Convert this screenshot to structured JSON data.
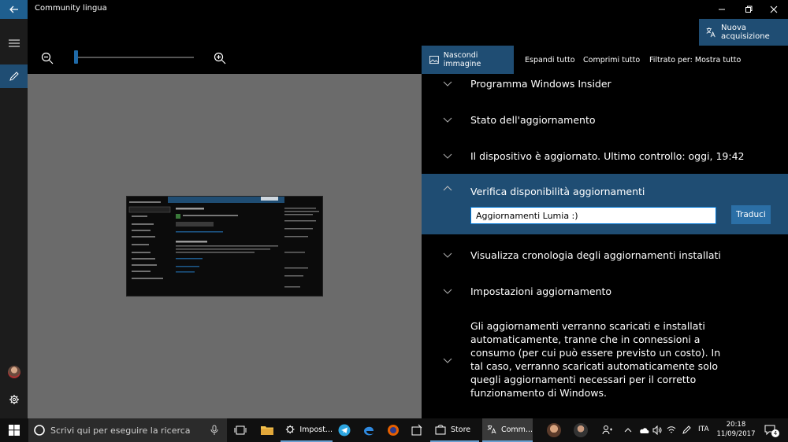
{
  "window": {
    "title": "Community lingua"
  },
  "header": {
    "new_acquisition": "Nuova acquisizione"
  },
  "toolbar": {
    "hide_image": "Nascondi immagine",
    "expand_all": "Espandi tutto",
    "collapse_all": "Comprimi tutto",
    "filter": "Filtrato per: Mostra tutto"
  },
  "list": {
    "items": [
      {
        "label": "Programma Windows Insider"
      },
      {
        "label": "Stato dell'aggiornamento"
      },
      {
        "label": "Il dispositivo è aggiornato. Ultimo controllo: oggi, 19:42"
      },
      {
        "label": "Verifica disponibilità aggiornamenti",
        "translation_value": "Aggiornamenti Lumia :)",
        "translate_button": "Traduci"
      },
      {
        "label": "Visualizza cronologia degli aggiornamenti installati"
      },
      {
        "label": "Impostazioni aggiornamento"
      },
      {
        "label": "Gli aggiornamenti verranno scaricati e installati automaticamente, tranne che in connessioni a consumo (per cui può essere previsto un costo). In tal caso, verranno scaricati automaticamente solo quegli aggiornamenti necessari per il corretto funzionamento di Windows."
      }
    ]
  },
  "zoom": {
    "level": 0.0
  },
  "taskbar": {
    "search_placeholder": "Scrivi qui per eseguire la ricerca",
    "apps": [
      {
        "label": "Impost..."
      },
      {
        "label": "Store"
      },
      {
        "label": "Comm..."
      }
    ],
    "language": "ITA",
    "time": "20:18",
    "date": "11/09/2017",
    "notifications": "4"
  },
  "colors": {
    "accent": "#1f4d73",
    "canvas": "#6b6b6b"
  }
}
